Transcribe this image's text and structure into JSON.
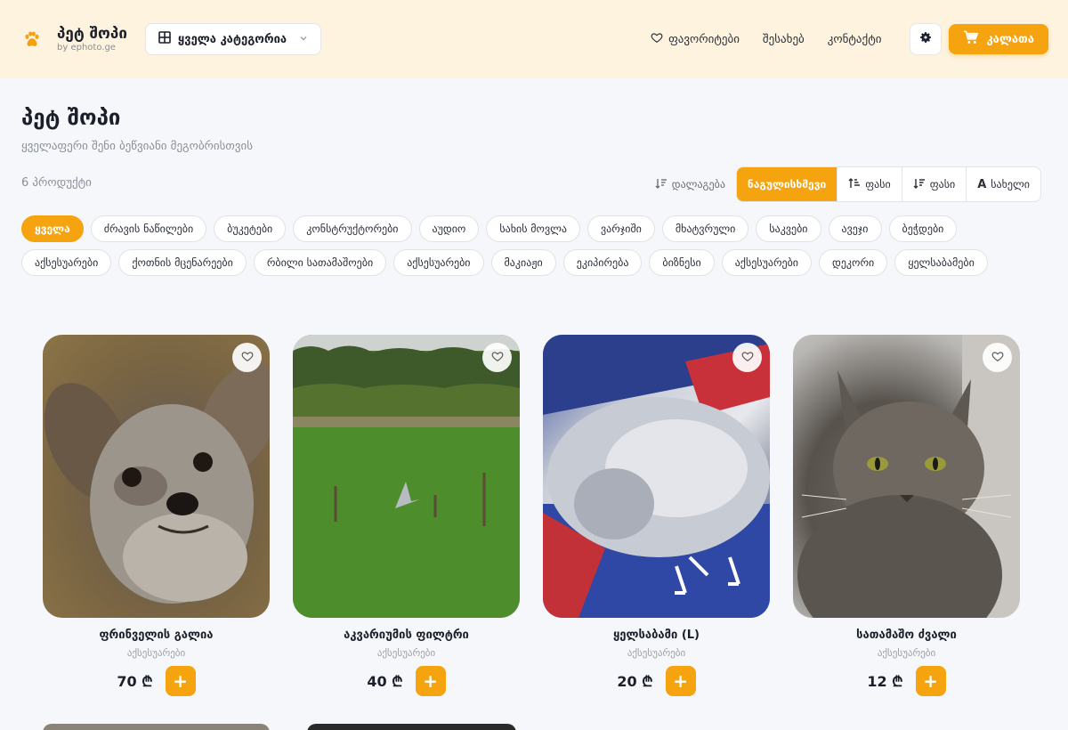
{
  "header": {
    "brand_title": "პეტ შოპი",
    "brand_sub": "by ephoto.ge",
    "category_select": "ყველა კატეგორია",
    "nav": {
      "favorites": "ფავორიტები",
      "about": "შესახებ",
      "contact": "კონტაქტი"
    },
    "cart": "კალათა"
  },
  "page": {
    "title": "პეტ შოპი",
    "subtitle": "ყველაფერი შენი ბეწვიანი მეგობრისთვის",
    "count": "6 პროდუქტი"
  },
  "sort": {
    "label": "დალაგება",
    "options": [
      "ნაგულისხმევი",
      "ფასი",
      "ფასი",
      "სახელი"
    ]
  },
  "chips": [
    "ყველა",
    "ძრავის ნაწილები",
    "ბუკეტები",
    "კონსტრუქტორები",
    "აუდიო",
    "სახის მოვლა",
    "ვარჯიში",
    "მხატვრული",
    "საკვები",
    "ავეჯი",
    "ბეჭდები",
    "აქსესუარები",
    "ქოთნის მცენარეები",
    "რბილი სათამაშოები",
    "აქსესუარები",
    "მაკიაჟი",
    "ეკიპირება",
    "ბიზნესი",
    "აქსესუარები",
    "დეკორი",
    "ყელსაბამები"
  ],
  "products": [
    {
      "name": "ფრინველის გალია",
      "category": "აქსესუარები",
      "price": "70 ₾"
    },
    {
      "name": "აკვარიუმის ფილტრი",
      "category": "აქსესუარები",
      "price": "40 ₾"
    },
    {
      "name": "ყელსაბამი (L)",
      "category": "აქსესუარები",
      "price": "20 ₾"
    },
    {
      "name": "სათამაშო ძვალი",
      "category": "აქსესუარები",
      "price": "12 ₾"
    }
  ],
  "icons": {
    "logo": "paw-icon",
    "category": "grid-icon",
    "favorites": "heart-icon",
    "theme": "gear-icon",
    "cart": "cart-icon",
    "add": "plus-icon"
  },
  "colors": {
    "accent": "#f5a30f",
    "header_bg": "#fdf3df"
  }
}
